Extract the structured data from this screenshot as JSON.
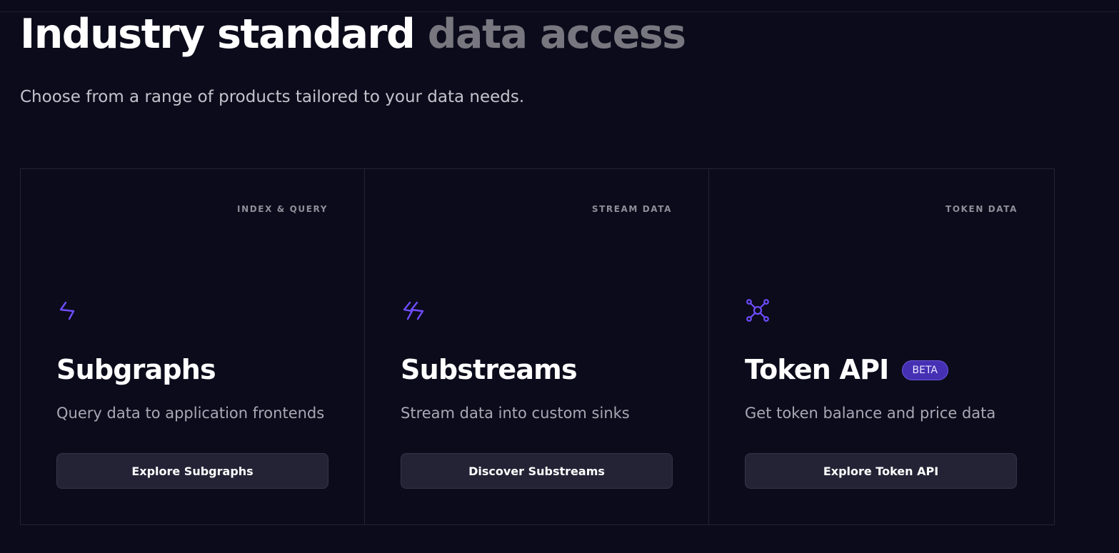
{
  "header": {
    "title_main": "Industry standard",
    "title_dim": "data access",
    "subtitle": "Choose from a range of products tailored to your data needs."
  },
  "colors": {
    "background": "#0c0b1b",
    "accent": "#6f4cff",
    "badge": "#4530b3",
    "button": "#242336"
  },
  "cards": [
    {
      "tag": "INDEX & QUERY",
      "icon": "subgraphs-bolt-icon",
      "title": "Subgraphs",
      "badge": "",
      "description": "Query data to application frontends",
      "button": "Explore Subgraphs"
    },
    {
      "tag": "STREAM DATA",
      "icon": "substreams-double-bolt-icon",
      "title": "Substreams",
      "badge": "",
      "description": "Stream data into custom sinks",
      "button": "Discover Substreams"
    },
    {
      "tag": "TOKEN DATA",
      "icon": "network-nodes-icon",
      "title": "Token API",
      "badge": "BETA",
      "description": "Get token balance and price data",
      "button": "Explore Token API"
    }
  ]
}
